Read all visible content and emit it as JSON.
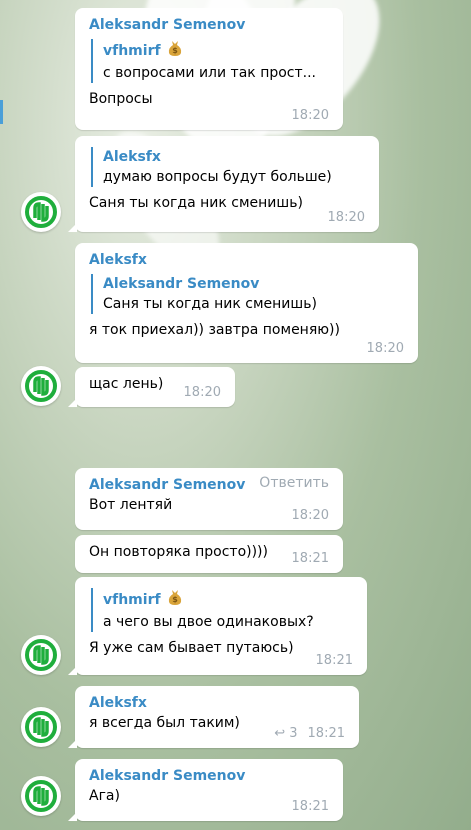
{
  "messages": [
    {
      "sender": "Aleksandr Semenov",
      "quote_name": "vfhmirf",
      "quote_text": "с вопросами или так прост...",
      "text": "Вопросы",
      "time": "18:20"
    },
    {
      "quote_name": "Aleksfx",
      "quote_text": "думаю вопросы будут больше)",
      "text": "Саня ты когда ник сменишь)",
      "time": "18:20"
    },
    {
      "sender": "Aleksfx",
      "quote_name": "Aleksandr Semenov",
      "quote_text": "Саня ты когда ник сменишь)",
      "text": "я ток приехал)) завтра поменяю))",
      "time": "18:20"
    },
    {
      "text": "щас лень)",
      "time": "18:20"
    },
    {
      "sender": "Aleksandr Semenov",
      "reply_label": "Ответить",
      "text": "Вот лентяй",
      "time": "18:20"
    },
    {
      "text": "Он повторяка просто))))",
      "time": "18:21"
    },
    {
      "quote_name": "vfhmirf",
      "quote_text": "а чего вы двое одинаковых?",
      "text": "Я уже сам бывает путаюсь)",
      "time": "18:21"
    },
    {
      "sender": "Aleksfx",
      "text": "я всегда был таким)",
      "forward_count": "3",
      "time": "18:21"
    },
    {
      "sender": "Aleksandr Semenov",
      "text": "Ага)",
      "time": "18:21"
    }
  ],
  "colors": {
    "accent": "#3a8bc5",
    "avatar_green": "#1fae3c",
    "time": "#a0aab3"
  },
  "icons": {
    "avatar": "green-logo-avatar-icon",
    "moneybag": "money-bag-icon",
    "forward": "forward-arrow-icon"
  }
}
